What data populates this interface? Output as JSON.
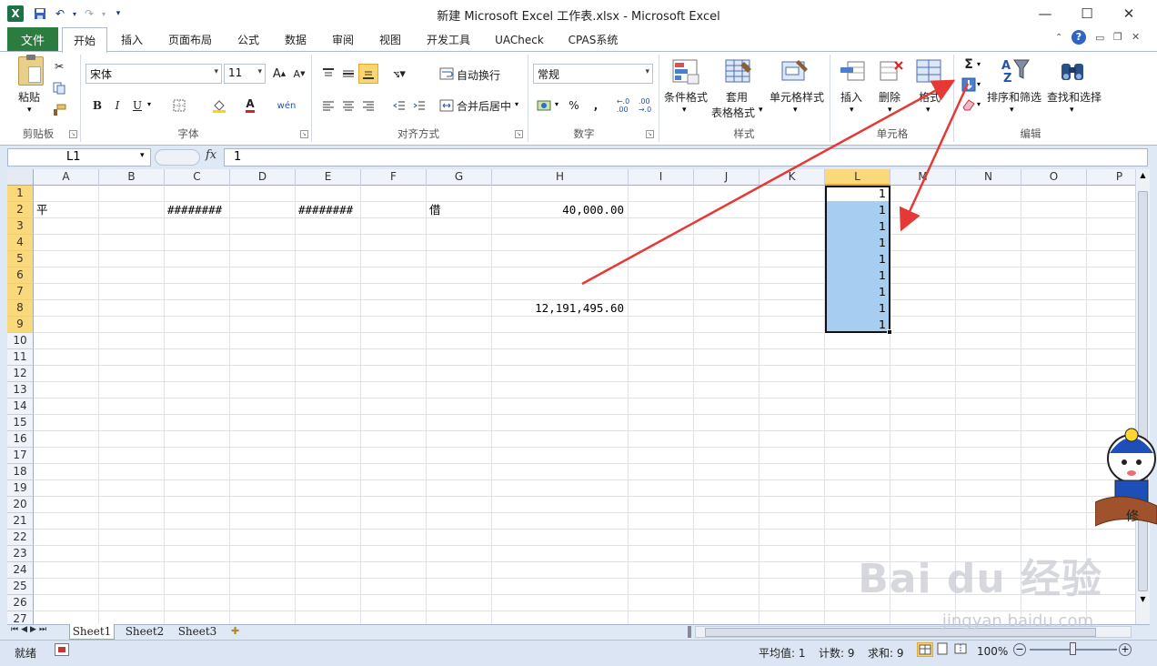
{
  "window": {
    "title": "新建 Microsoft Excel 工作表.xlsx  -  Microsoft Excel",
    "app_icon": "X",
    "controls": {
      "minimize": "—",
      "maximize": "☐",
      "close": "✕"
    }
  },
  "ribbon_tabs": [
    {
      "label": "文件"
    },
    {
      "label": "开始"
    },
    {
      "label": "插入"
    },
    {
      "label": "页面布局"
    },
    {
      "label": "公式"
    },
    {
      "label": "数据"
    },
    {
      "label": "审阅"
    },
    {
      "label": "视图"
    },
    {
      "label": "开发工具"
    },
    {
      "label": "UACheck"
    },
    {
      "label": "CPAS系统"
    }
  ],
  "ribbon": {
    "clipboard": {
      "paste": "粘贴",
      "group": "剪贴板"
    },
    "font": {
      "name": "宋体",
      "size": "11",
      "group": "字体",
      "bold": "B",
      "italic": "I",
      "underline": "U"
    },
    "alignment": {
      "wrap": "自动换行",
      "merge": "合并后居中",
      "group": "对齐方式"
    },
    "number": {
      "format": "常规",
      "percent": "%",
      "comma": ",",
      "group": "数字"
    },
    "styles": {
      "conditional": "条件格式",
      "table_format_line1": "套用",
      "table_format_line2": "表格格式",
      "cell_styles": "单元格样式",
      "group": "样式"
    },
    "cells": {
      "insert": "插入",
      "delete": "删除",
      "format": "格式",
      "group": "单元格"
    },
    "editing": {
      "sort": "排序和筛选",
      "find": "查找和选择",
      "group": "编辑",
      "sum": "Σ"
    }
  },
  "formula_bar": {
    "name_box": "L1",
    "fx": "fx",
    "value": "1"
  },
  "columns": [
    "A",
    "B",
    "C",
    "D",
    "E",
    "F",
    "G",
    "H",
    "I",
    "J",
    "K",
    "L",
    "M",
    "N",
    "O",
    "P"
  ],
  "rows": [
    "1",
    "2",
    "3",
    "4",
    "5",
    "6",
    "7",
    "8",
    "9",
    "10",
    "11",
    "12",
    "13",
    "14",
    "15",
    "16",
    "17",
    "18",
    "19",
    "20",
    "21",
    "22",
    "23",
    "24",
    "25",
    "26",
    "27"
  ],
  "cells": {
    "A2": "平",
    "C2": "########",
    "E2": "########",
    "G2": "借",
    "H2": "40,000.00",
    "H8": "12,191,495.60",
    "L1": "1",
    "L2": "1",
    "L3": "1",
    "L4": "1",
    "L5": "1",
    "L6": "1",
    "L7": "1",
    "L8": "1",
    "L9": "1"
  },
  "sheets": [
    "Sheet1",
    "Sheet2",
    "Sheet3"
  ],
  "status": {
    "mode": "就绪",
    "average": "平均值: 1",
    "count": "计数: 9",
    "sum": "求和: 9",
    "zoom": "100%"
  },
  "watermark": {
    "logo": "Bai  du 经验",
    "url": "jingyan.baidu.com"
  },
  "colors": {
    "accent_green": "#2c7c3f",
    "selection": "#a7cdf0",
    "header_selected": "#f9d97b",
    "arrow": "#e53935"
  }
}
